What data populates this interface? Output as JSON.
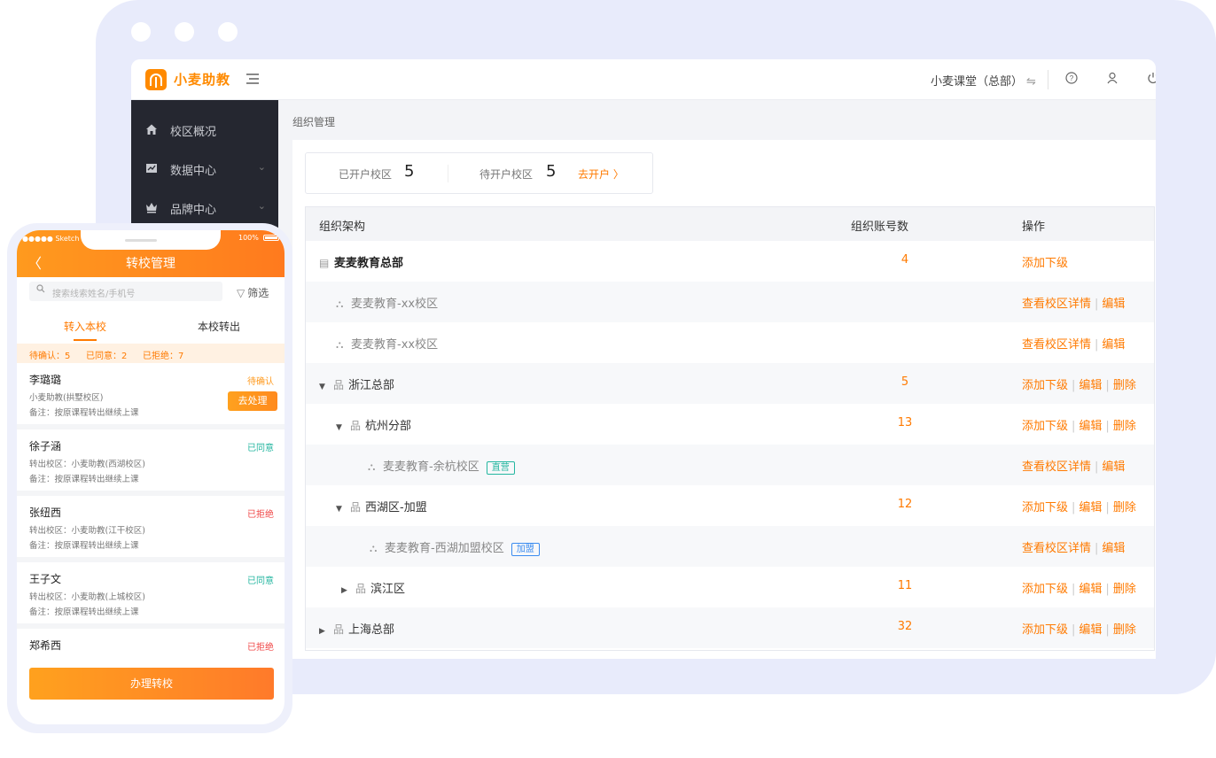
{
  "desktop": {
    "brand": "小麦助教",
    "header": {
      "campus_switch": "小麦课堂（总部）",
      "switch_icon": "swap-icon",
      "help_icon": "question-circle-icon",
      "user_icon": "user-icon",
      "power_icon": "power-icon"
    },
    "sidebar": {
      "items": [
        {
          "label": "校区概况",
          "icon": "home-icon"
        },
        {
          "label": "数据中心",
          "icon": "chart-icon"
        },
        {
          "label": "品牌中心",
          "icon": "crown-icon"
        }
      ]
    },
    "breadcrumb": "组织管理",
    "stats": {
      "opened_label": "已开户校区",
      "opened_value": "5",
      "pending_label": "待开户校区",
      "pending_value": "5",
      "action": "去开户 〉"
    },
    "table": {
      "columns": [
        "组织架构",
        "组织账号数",
        "操作"
      ],
      "rows": [
        {
          "name": "麦麦教育总部",
          "count": "4",
          "ops": [
            "添加下级"
          ],
          "tag": ""
        },
        {
          "name": "麦麦教育-xx校区",
          "count": "",
          "ops": [
            "查看校区详情",
            "编辑"
          ],
          "tag": ""
        },
        {
          "name": "麦麦教育-xx校区",
          "count": "",
          "ops": [
            "查看校区详情",
            "编辑"
          ],
          "tag": ""
        },
        {
          "name": "浙江总部",
          "count": "5",
          "ops": [
            "添加下级",
            "编辑",
            "删除"
          ],
          "tag": ""
        },
        {
          "name": "杭州分部",
          "count": "13",
          "ops": [
            "添加下级",
            "编辑",
            "删除"
          ],
          "tag": ""
        },
        {
          "name": "麦麦教育-余杭校区",
          "count": "",
          "ops": [
            "查看校区详情",
            "编辑"
          ],
          "tag": "直营"
        },
        {
          "name": "西湖区-加盟",
          "count": "12",
          "ops": [
            "添加下级",
            "编辑",
            "删除"
          ],
          "tag": ""
        },
        {
          "name": "麦麦教育-西湖加盟校区",
          "count": "",
          "ops": [
            "查看校区详情",
            "编辑"
          ],
          "tag": "加盟"
        },
        {
          "name": "滨江区",
          "count": "11",
          "ops": [
            "添加下级",
            "编辑",
            "删除"
          ],
          "tag": ""
        },
        {
          "name": "上海总部",
          "count": "32",
          "ops": [
            "添加下级",
            "编辑",
            "删除"
          ],
          "tag": ""
        }
      ]
    }
  },
  "phone": {
    "status_left": "●●●●● Sketch ᯤ",
    "status_right": "100%",
    "title": "转校管理",
    "search_placeholder": "搜索线索姓名/手机号",
    "filter_label": "筛选",
    "tabs": [
      "转入本校",
      "本校转出"
    ],
    "summary": {
      "pending": "待确认：5",
      "agreed": "已同意：2",
      "rejected": "已拒绝：7"
    },
    "cards": [
      {
        "name": "李璐璐",
        "status": "待确认",
        "line1": "小麦助教(拱墅校区)",
        "line2": "备注：按原课程转出继续上课",
        "action": "去处理"
      },
      {
        "name": "徐子涵",
        "status": "已同意",
        "line1": "转出校区：小麦助教(西湖校区)",
        "line2": "备注：按原课程转出继续上课"
      },
      {
        "name": "张纽西",
        "status": "已拒绝",
        "line1": "转出校区：小麦助教(江干校区)",
        "line2": "备注：按原课程转出继续上课"
      },
      {
        "name": "王子文",
        "status": "已同意",
        "line1": "转出校区：小麦助教(上城校区)",
        "line2": "备注：按原课程转出继续上课"
      },
      {
        "name": "郑希西",
        "status": "已拒绝",
        "line1": "",
        "line2": ""
      }
    ],
    "bottom_button": "办理转校"
  },
  "colors": {
    "accent": "#ff7a00",
    "sidebar_bg": "#252730",
    "frame_bg": "#e8ebfb",
    "agree": "#24b6a0",
    "reject": "#f04848"
  }
}
